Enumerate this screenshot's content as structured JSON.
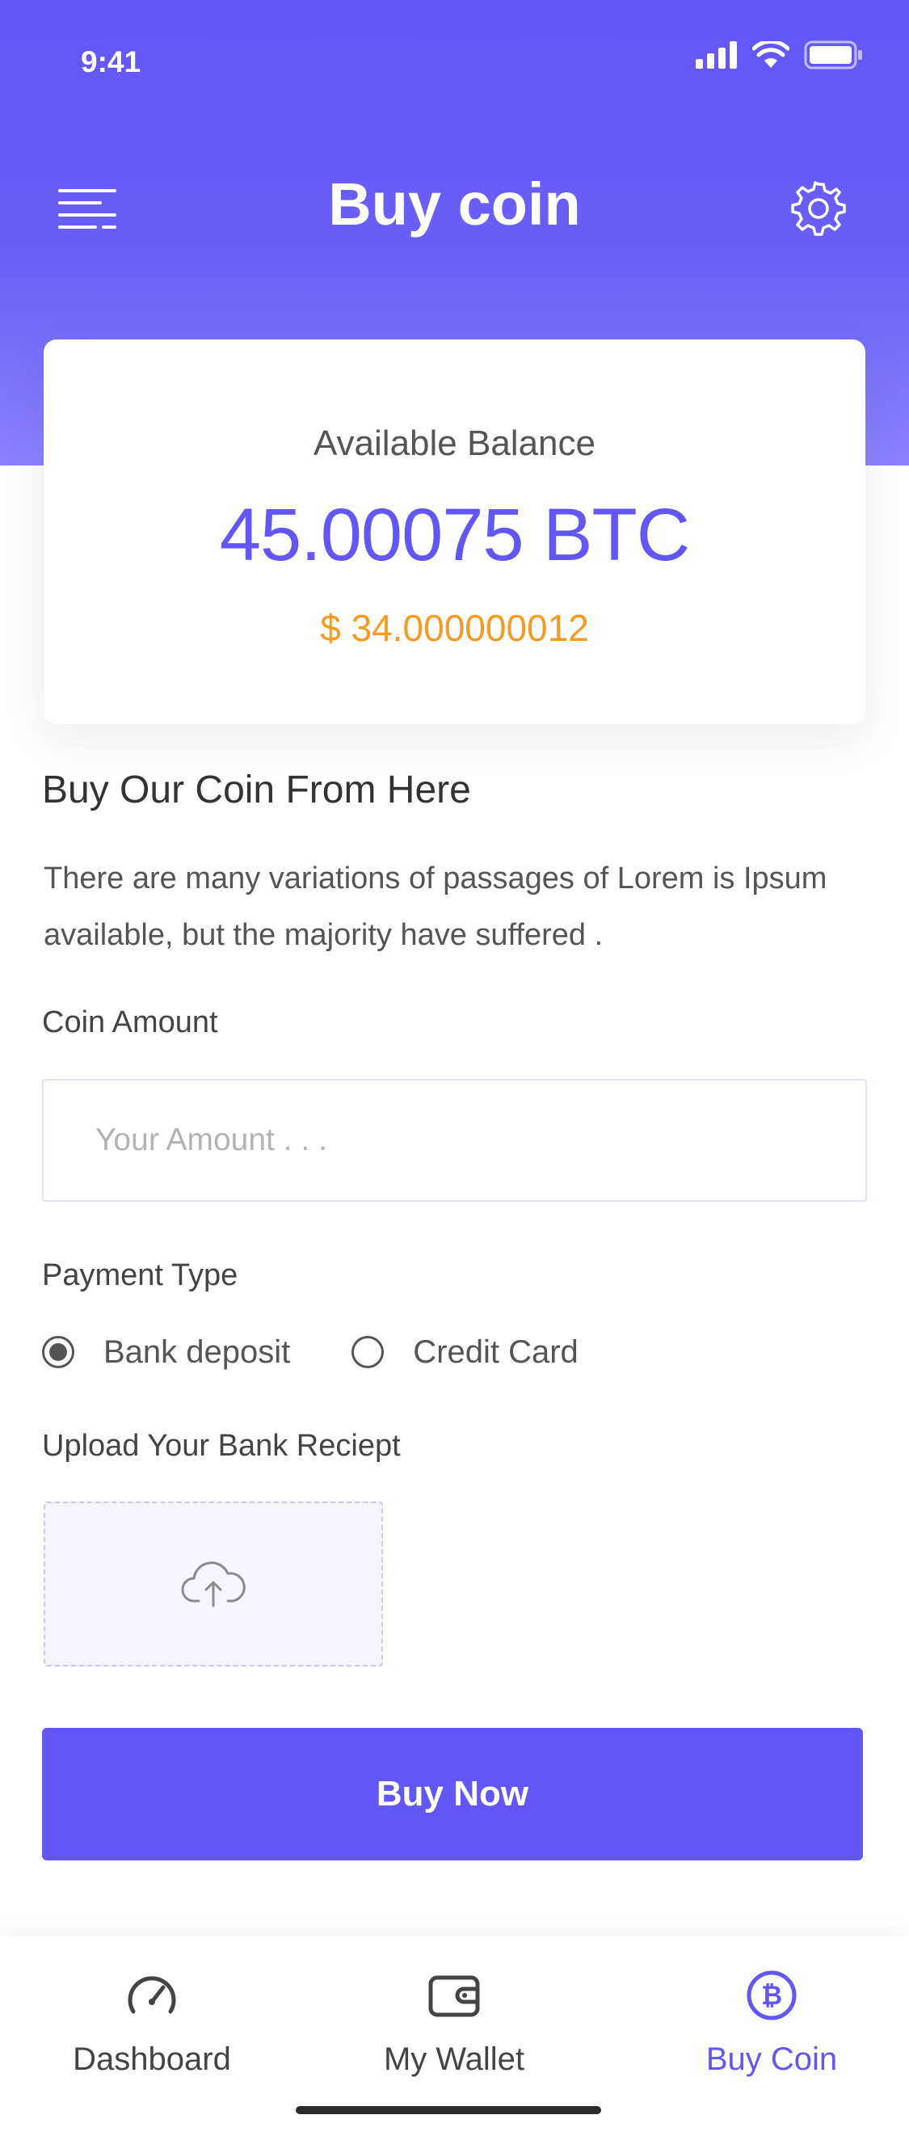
{
  "status_bar": {
    "time": "9:41"
  },
  "header": {
    "title": "Buy coin",
    "menu_icon": "menu-icon",
    "settings_icon": "gear-icon"
  },
  "balance": {
    "label": "Available Balance",
    "btc": "45.00075 BTC",
    "usd": "$ 34.000000012"
  },
  "section": {
    "title": "Buy Our Coin From Here",
    "description": "There are many variations of passages of Lorem is Ipsum available, but the majority have suffered ."
  },
  "form": {
    "amount_label": "Coin Amount",
    "amount_placeholder": "Your Amount . . .",
    "amount_value": "",
    "payment_label": "Payment Type",
    "payment_options": [
      {
        "label": "Bank deposit",
        "selected": true
      },
      {
        "label": "Credit Card",
        "selected": false
      }
    ],
    "upload_label": "Upload Your Bank Reciept",
    "upload_icon": "cloud-upload-icon",
    "submit_label": "Buy Now"
  },
  "bottom_nav": {
    "items": [
      {
        "label": "Dashboard",
        "icon": "speedometer-icon",
        "active": false
      },
      {
        "label": "My Wallet",
        "icon": "wallet-icon",
        "active": false
      },
      {
        "label": "Buy Coin",
        "icon": "bitcoin-icon",
        "active": true
      }
    ]
  },
  "colors": {
    "accent": "#6356f7",
    "usd_accent": "#f59a23",
    "text_dark": "#333333",
    "text_body": "#555555"
  }
}
